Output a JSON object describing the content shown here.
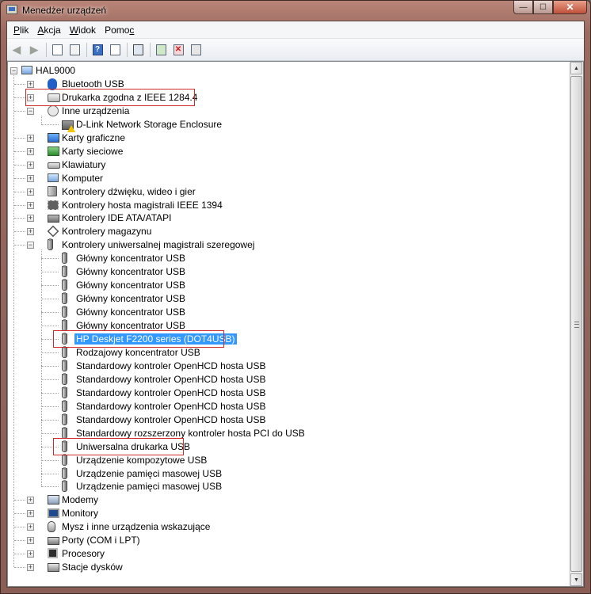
{
  "window": {
    "title": "Menedżer urządzeń",
    "minimize": "—",
    "maximize": "☐",
    "close": "✕"
  },
  "menu": [
    {
      "pre": "",
      "accel": "P",
      "post": "lik"
    },
    {
      "pre": "",
      "accel": "A",
      "post": "kcja"
    },
    {
      "pre": "",
      "accel": "W",
      "post": "idok"
    },
    {
      "pre": "Pomo",
      "accel": "c",
      "post": ""
    }
  ],
  "toolbar": {
    "back": "back-arrow-icon",
    "forward": "forward-arrow-icon",
    "help_glyph": "?"
  },
  "tree": {
    "root": "HAL9000",
    "items": [
      {
        "label": "Bluetooth USB",
        "icon": "bluetooth-icon",
        "expander": "+"
      },
      {
        "label": "Drukarka zgodna z IEEE 1284.4",
        "icon": "printer-icon",
        "expander": "+"
      },
      {
        "label": "Inne urządzenia",
        "icon": "unknown-device-icon",
        "expander": "−"
      },
      {
        "label": "D-Link Network Storage Enclosure",
        "icon": "warning-device-icon",
        "child": true
      },
      {
        "label": "Karty graficzne",
        "icon": "display-adapter-icon",
        "expander": "+"
      },
      {
        "label": "Karty sieciowe",
        "icon": "network-adapter-icon",
        "expander": "+"
      },
      {
        "label": "Klawiatury",
        "icon": "keyboard-icon",
        "expander": "+"
      },
      {
        "label": "Komputer",
        "icon": "computer-icon",
        "expander": "+"
      },
      {
        "label": "Kontrolery dźwięku, wideo i gier",
        "icon": "sound-icon",
        "expander": "+"
      },
      {
        "label": "Kontrolery hosta magistrali IEEE 1394",
        "icon": "firewire-icon",
        "expander": "+"
      },
      {
        "label": "Kontrolery IDE ATA/ATAPI",
        "icon": "ide-controller-icon",
        "expander": "+"
      },
      {
        "label": "Kontrolery magazynu",
        "icon": "storage-controller-icon",
        "expander": "+"
      },
      {
        "label": "Kontrolery uniwersalnej magistrali szeregowej",
        "icon": "usb-controller-icon",
        "expander": "−"
      },
      {
        "label": "Główny koncentrator USB",
        "icon": "usb-device-icon",
        "child": true
      },
      {
        "label": "Główny koncentrator USB",
        "icon": "usb-device-icon",
        "child": true
      },
      {
        "label": "Główny koncentrator USB",
        "icon": "usb-device-icon",
        "child": true
      },
      {
        "label": "Główny koncentrator USB",
        "icon": "usb-device-icon",
        "child": true
      },
      {
        "label": "Główny koncentrator USB",
        "icon": "usb-device-icon",
        "child": true
      },
      {
        "label": "Główny koncentrator USB",
        "icon": "usb-device-icon",
        "child": true
      },
      {
        "label": "HP Deskjet F2200 series (DOT4USB)",
        "icon": "usb-device-icon",
        "child": true,
        "selected": true
      },
      {
        "label": "Rodzajowy koncentrator USB",
        "icon": "usb-device-icon",
        "child": true
      },
      {
        "label": "Standardowy kontroler OpenHCD hosta USB",
        "icon": "usb-device-icon",
        "child": true
      },
      {
        "label": "Standardowy kontroler OpenHCD hosta USB",
        "icon": "usb-device-icon",
        "child": true
      },
      {
        "label": "Standardowy kontroler OpenHCD hosta USB",
        "icon": "usb-device-icon",
        "child": true
      },
      {
        "label": "Standardowy kontroler OpenHCD hosta USB",
        "icon": "usb-device-icon",
        "child": true
      },
      {
        "label": "Standardowy kontroler OpenHCD hosta USB",
        "icon": "usb-device-icon",
        "child": true
      },
      {
        "label": "Standardowy rozszerzony kontroler hosta PCI do USB",
        "icon": "usb-device-icon",
        "child": true
      },
      {
        "label": "Uniwersalna drukarka USB",
        "icon": "usb-device-icon",
        "child": true
      },
      {
        "label": "Urządzenie kompozytowe USB",
        "icon": "usb-device-icon",
        "child": true
      },
      {
        "label": "Urządzenie pamięci masowej USB",
        "icon": "usb-device-icon",
        "child": true
      },
      {
        "label": "Urządzenie pamięci masowej USB",
        "icon": "usb-device-icon",
        "child": true
      },
      {
        "label": "Modemy",
        "icon": "modem-icon",
        "expander": "+"
      },
      {
        "label": "Monitory",
        "icon": "monitor-icon",
        "expander": "+"
      },
      {
        "label": "Mysz i inne urządzenia wskazujące",
        "icon": "mouse-icon",
        "expander": "+"
      },
      {
        "label": "Porty (COM i LPT)",
        "icon": "port-icon",
        "expander": "+"
      },
      {
        "label": "Procesory",
        "icon": "processor-icon",
        "expander": "+"
      },
      {
        "label": "Stacje dysków",
        "icon": "disk-drive-icon",
        "expander": "+"
      }
    ]
  },
  "annotations": {
    "color": "#d12828",
    "highlighted": [
      "Drukarka zgodna z IEEE 1284.4",
      "HP Deskjet F2200 series (DOT4USB)",
      "Uniwersalna drukarka USB"
    ]
  },
  "colors": {
    "selection": "#3399ff",
    "title_bar": "#9b6a60"
  }
}
